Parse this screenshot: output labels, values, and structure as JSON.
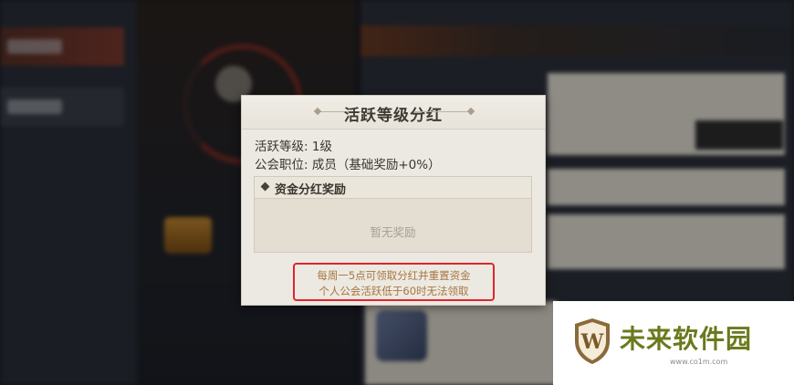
{
  "dialog": {
    "title": "活跃等级分红",
    "activity_level_label": "活跃等级:",
    "activity_level_value": "1级",
    "position_label": "公会职位:",
    "position_value": "成员（基础奖励+0%）",
    "reward_section_title": "资金分红奖励",
    "empty_reward_text": "暂无奖励",
    "notice_line1": "每周一5点可领取分红并重置资金",
    "notice_line2": "个人公会活跃低于60时无法领取"
  },
  "watermark": {
    "name": "未来软件园",
    "url": "www.co1m.com",
    "logo_letter": "W"
  },
  "colors": {
    "notice_border": "#e0252a",
    "notice_text": "#a7763e",
    "watermark_green": "#6a7a1e"
  }
}
